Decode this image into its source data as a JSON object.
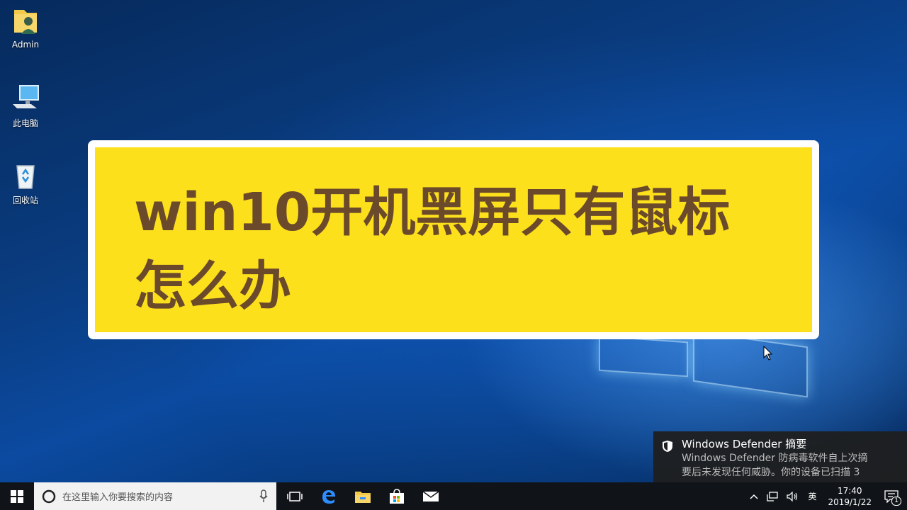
{
  "desktop": {
    "icons": [
      {
        "label": "Admin",
        "icon": "user-folder-icon"
      },
      {
        "label": "此电脑",
        "icon": "computer-icon"
      },
      {
        "label": "回收站",
        "icon": "recycle-bin-icon"
      }
    ]
  },
  "banner": {
    "title": "win10开机黑屏只有鼠标怎么办"
  },
  "notification": {
    "title": "Windows Defender 摘要",
    "body_line1": "Windows Defender 防病毒软件自上次摘",
    "body_line2": "要后未发现任何威胁。你的设备已扫描 3",
    "icon": "shield-icon"
  },
  "taskbar": {
    "search_placeholder": "在这里输入你要搜索的内容",
    "apps": [
      "task-view-icon",
      "edge-icon",
      "file-explorer-icon",
      "store-icon",
      "mail-icon"
    ],
    "tray": {
      "ime": "英",
      "time": "17:40",
      "date": "2019/1/22",
      "notification_count": "1"
    }
  },
  "colors": {
    "banner_fill": "#fde01c",
    "banner_text": "#6b4a2b",
    "taskbar": "#101418"
  }
}
